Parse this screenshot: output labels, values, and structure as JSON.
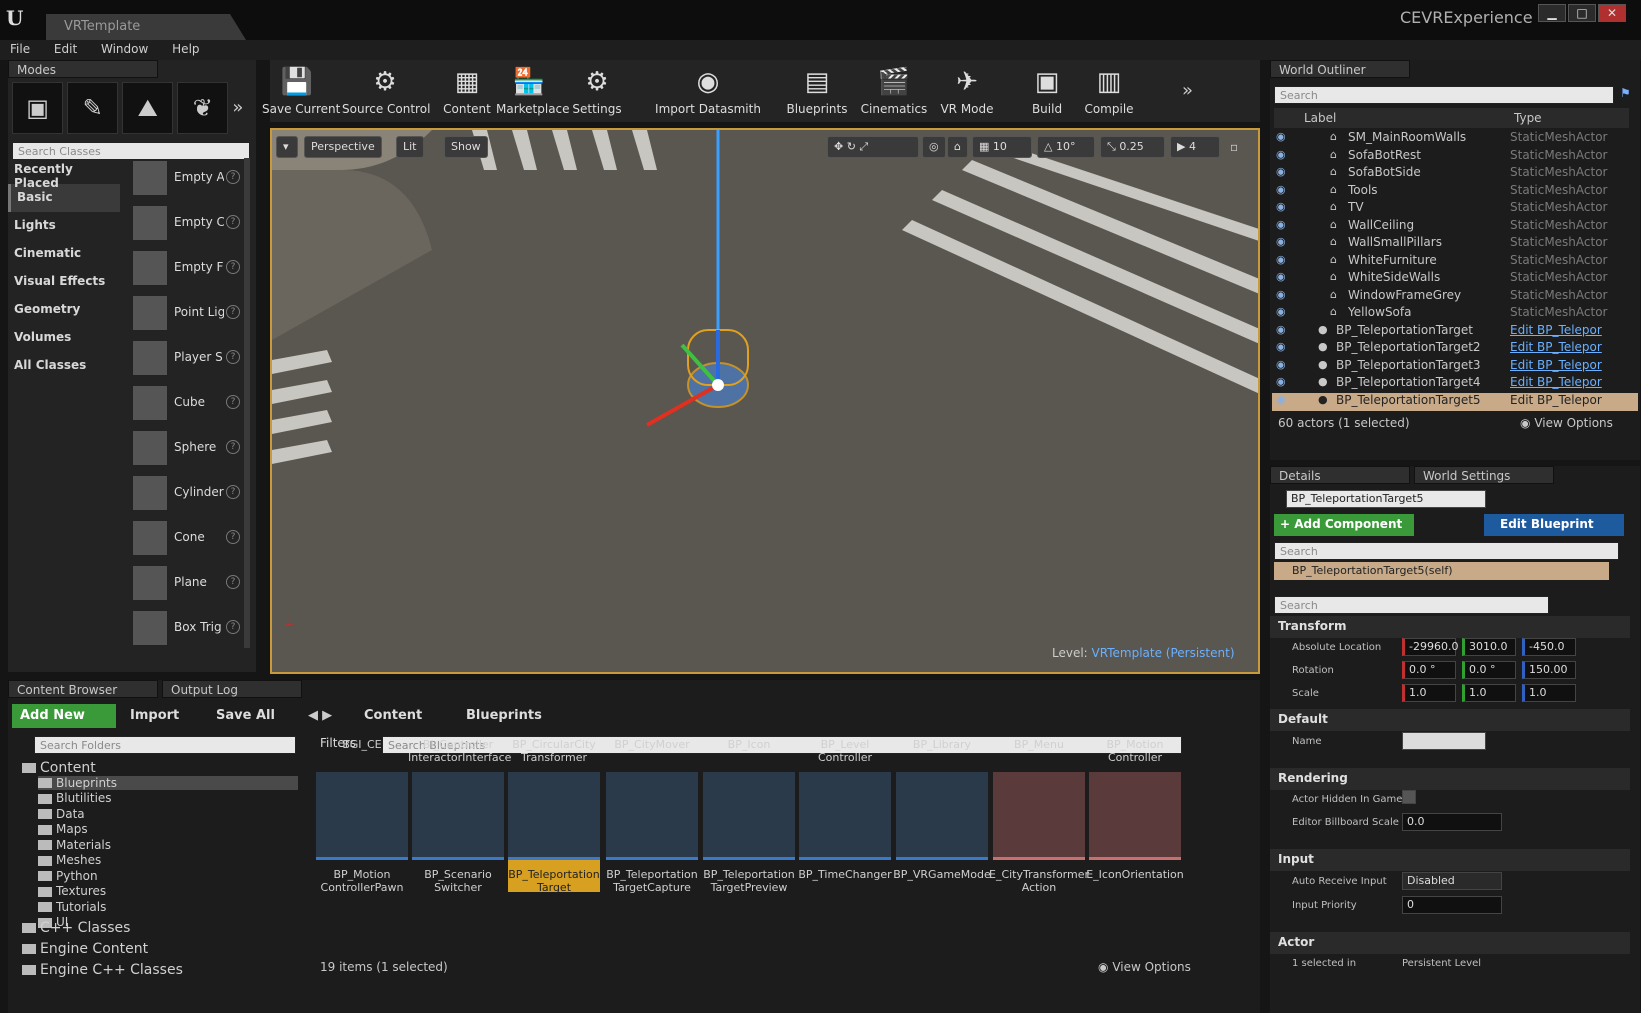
{
  "window": {
    "tab_title": "VRTemplate",
    "project": "CEVRExperience"
  },
  "menu": [
    "File",
    "Edit",
    "Window",
    "Help"
  ],
  "modes": {
    "tab": "Modes",
    "search_placeholder": "Search Classes",
    "categories": [
      "Recently Placed",
      "Basic",
      "Lights",
      "Cinematic",
      "Visual Effects",
      "Geometry",
      "Volumes",
      "All Classes"
    ],
    "selected_category": "Basic",
    "items": [
      "Empty A",
      "Empty C",
      "Empty F",
      "Point Lig",
      "Player S",
      "Cube",
      "Sphere",
      "Cylinder",
      "Cone",
      "Plane",
      "Box Trig"
    ]
  },
  "toolbar": [
    {
      "label": "Save Current",
      "icon": "save-icon"
    },
    {
      "label": "Source Control",
      "icon": "source-control-icon"
    },
    {
      "label": "Content",
      "icon": "content-icon"
    },
    {
      "label": "Marketplace",
      "icon": "marketplace-icon"
    },
    {
      "label": "Settings",
      "icon": "settings-icon"
    },
    {
      "label": "Import Datasmith",
      "icon": "datasmith-icon"
    },
    {
      "label": "Blueprints",
      "icon": "blueprints-icon"
    },
    {
      "label": "Cinematics",
      "icon": "cinematics-icon"
    },
    {
      "label": "VR Mode",
      "icon": "vr-mode-icon"
    },
    {
      "label": "Build",
      "icon": "build-icon"
    },
    {
      "label": "Compile",
      "icon": "compile-icon"
    }
  ],
  "viewport": {
    "perspective": "Perspective",
    "lit": "Lit",
    "show": "Show",
    "grid_snap": "10",
    "rot_snap": "10°",
    "scale_snap": "0.25",
    "camera_speed": "4",
    "level_label": "Level:",
    "level_name": "VRTemplate (Persistent)"
  },
  "outliner": {
    "tab": "World Outliner",
    "search_placeholder": "Search",
    "col_label": "Label",
    "col_type": "Type",
    "rows": [
      {
        "label": "SM_MainRoomWalls",
        "type": "StaticMeshActor"
      },
      {
        "label": "SofaBotRest",
        "type": "StaticMeshActor"
      },
      {
        "label": "SofaBotSide",
        "type": "StaticMeshActor"
      },
      {
        "label": "Tools",
        "type": "StaticMeshActor"
      },
      {
        "label": "TV",
        "type": "StaticMeshActor"
      },
      {
        "label": "WallCeiling",
        "type": "StaticMeshActor"
      },
      {
        "label": "WallSmallPillars",
        "type": "StaticMeshActor"
      },
      {
        "label": "WhiteFurniture",
        "type": "StaticMeshActor"
      },
      {
        "label": "WhiteSideWalls",
        "type": "StaticMeshActor"
      },
      {
        "label": "WindowFrameGrey",
        "type": "StaticMeshActor"
      },
      {
        "label": "YellowSofa",
        "type": "StaticMeshActor"
      },
      {
        "label": "BP_TeleportationTarget",
        "type": "Edit BP_Telepor"
      },
      {
        "label": "BP_TeleportationTarget2",
        "type": "Edit BP_Telepor"
      },
      {
        "label": "BP_TeleportationTarget3",
        "type": "Edit BP_Telepor"
      },
      {
        "label": "BP_TeleportationTarget4",
        "type": "Edit BP_Telepor"
      },
      {
        "label": "BP_TeleportationTarget5",
        "type": "Edit BP_Telepor"
      }
    ],
    "status": "60 actors (1 selected)",
    "view_options": "View Options"
  },
  "details": {
    "tab": "Details",
    "tab2": "World Settings",
    "actor_name": "BP_TeleportationTarget5",
    "add_component": "+ Add Component",
    "edit_blueprint": "Edit Blueprint",
    "search_placeholder": "Search",
    "self_row": "BP_TeleportationTarget5(self)",
    "transform": "Transform",
    "abs_location": "Absolute Location",
    "loc": [
      "-29960.0",
      "3010.0",
      "-450.0"
    ],
    "rotation": "Rotation",
    "rot": [
      "0.0 °",
      "0.0 °",
      "150.00"
    ],
    "scale": "Scale",
    "scl": [
      "1.0",
      "1.0",
      "1.0"
    ],
    "default": "Default",
    "name": "Name",
    "rendering": "Rendering",
    "actor_hidden": "Actor Hidden In Game",
    "billboard_scale": "Editor Billboard Scale",
    "billboard_val": "0.0",
    "input": "Input",
    "auto_receive": "Auto Receive Input",
    "auto_receive_val": "Disabled",
    "input_priority": "Input Priority",
    "input_priority_val": "0",
    "actor": "Actor",
    "selected_in": "1 selected in",
    "persistent_level": "Persistent Level"
  },
  "content_browser": {
    "tab": "Content Browser",
    "tab2": "Output Log",
    "add_new": "Add New",
    "import": "Import",
    "save_all": "Save All",
    "path": [
      "Content",
      "Blueprints"
    ],
    "search_folders": "Search Folders",
    "filters": "Filters",
    "search_blueprints": "Search Blueprints",
    "folders": [
      "Content",
      "Blueprints",
      "Blutilities",
      "Data",
      "Maps",
      "Materials",
      "Meshes",
      "Python",
      "Textures",
      "Tutorials",
      "UI",
      "C++ Classes",
      "Engine Content",
      "Engine C++ Classes"
    ],
    "top_labels": [
      "BGI_CE",
      "BI_Controller InteractorInterface",
      "BP_CircularCity Transformer",
      "BP_CityMover",
      "BP_Icon",
      "BP_Level Controller",
      "BP_Library",
      "BP_Menu",
      "BP_Motion Controller"
    ],
    "assets": [
      "BP_Motion ControllerPawn",
      "BP_Scenario Switcher",
      "BP_Teleportation Target",
      "BP_Teleportation TargetCapture",
      "BP_Teleportation TargetPreview",
      "BP_TimeChanger",
      "BP_VRGameMode",
      "E_CityTransformer Action",
      "E_IconOrientation"
    ],
    "status": "19 items (1 selected)",
    "view_options": "View Options"
  }
}
